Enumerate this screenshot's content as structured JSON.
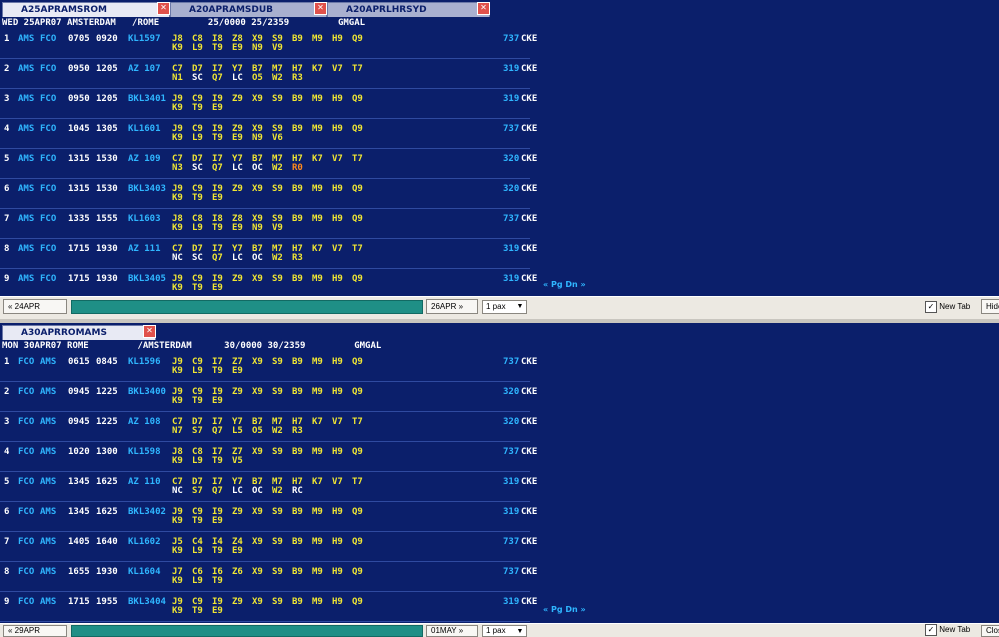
{
  "top": {
    "tabs": [
      {
        "label": "A25APRAMSROM",
        "active": true
      },
      {
        "label": "A20APRAMSDUB",
        "active": false
      },
      {
        "label": "A20APRLHRSYD",
        "active": false
      }
    ],
    "header": "WED 25APR07 AMSTERDAM   /ROME         25/0000 25/2359         GMGAL",
    "rows": [
      {
        "n": "1",
        "dep": "AMS",
        "arr": "FCO",
        "t1": "0705",
        "t2": "0920",
        "flt": "KL1597",
        "l1": [
          "J8",
          "C8",
          "I8",
          "Z8",
          "X9",
          "S9",
          "B9",
          "M9",
          "H9",
          "Q9"
        ],
        "l2": [
          "K9",
          "L9",
          "T9",
          "E9",
          "N9",
          "V9"
        ],
        "eq": "737"
      },
      {
        "n": "2",
        "dep": "AMS",
        "arr": "FCO",
        "t1": "0950",
        "t2": "1205",
        "flt": "AZ 107",
        "l1": [
          "C7",
          "D7",
          "I7",
          "Y7",
          "B7",
          "M7",
          "H7",
          "K7",
          "V7",
          "T7"
        ],
        "l2": [
          "N1",
          "SC",
          "Q7",
          "LC",
          "O5",
          "W2",
          "R3"
        ],
        "eq": "319"
      },
      {
        "n": "3",
        "dep": "AMS",
        "arr": "FCO",
        "t1": "0950",
        "t2": "1205",
        "flt": "BKL3401",
        "l1": [
          "J9",
          "C9",
          "I9",
          "Z9",
          "X9",
          "S9",
          "B9",
          "M9",
          "H9",
          "Q9"
        ],
        "l2": [
          "K9",
          "T9",
          "E9"
        ],
        "eq": "319"
      },
      {
        "n": "4",
        "dep": "AMS",
        "arr": "FCO",
        "t1": "1045",
        "t2": "1305",
        "flt": "KL1601",
        "l1": [
          "J9",
          "C9",
          "I9",
          "Z9",
          "X9",
          "S9",
          "B9",
          "M9",
          "H9",
          "Q9"
        ],
        "l2": [
          "K9",
          "L9",
          "T9",
          "E9",
          "N9",
          "V6"
        ],
        "eq": "737"
      },
      {
        "n": "5",
        "dep": "AMS",
        "arr": "FCO",
        "t1": "1315",
        "t2": "1530",
        "flt": "AZ 109",
        "l1": [
          "C7",
          "D7",
          "I7",
          "Y7",
          "B7",
          "M7",
          "H7",
          "K7",
          "V7",
          "T7"
        ],
        "l2": [
          "N3",
          "SC",
          "Q7",
          "LC",
          "OC",
          "W2",
          "R0"
        ],
        "eq": "320"
      },
      {
        "n": "6",
        "dep": "AMS",
        "arr": "FCO",
        "t1": "1315",
        "t2": "1530",
        "flt": "BKL3403",
        "l1": [
          "J9",
          "C9",
          "I9",
          "Z9",
          "X9",
          "S9",
          "B9",
          "M9",
          "H9",
          "Q9"
        ],
        "l2": [
          "K9",
          "T9",
          "E9"
        ],
        "eq": "320"
      },
      {
        "n": "7",
        "dep": "AMS",
        "arr": "FCO",
        "t1": "1335",
        "t2": "1555",
        "flt": "KL1603",
        "l1": [
          "J8",
          "C8",
          "I8",
          "Z8",
          "X9",
          "S9",
          "B9",
          "M9",
          "H9",
          "Q9"
        ],
        "l2": [
          "K9",
          "L9",
          "T9",
          "E9",
          "N9",
          "V9"
        ],
        "eq": "737"
      },
      {
        "n": "8",
        "dep": "AMS",
        "arr": "FCO",
        "t1": "1715",
        "t2": "1930",
        "flt": "AZ 111",
        "l1": [
          "C7",
          "D7",
          "I7",
          "Y7",
          "B7",
          "M7",
          "H7",
          "K7",
          "V7",
          "T7"
        ],
        "l2": [
          "NC",
          "SC",
          "Q7",
          "LC",
          "OC",
          "W2",
          "R3"
        ],
        "eq": "319"
      },
      {
        "n": "9",
        "dep": "AMS",
        "arr": "FCO",
        "t1": "1715",
        "t2": "1930",
        "flt": "BKL3405",
        "l1": [
          "J9",
          "C9",
          "I9",
          "Z9",
          "X9",
          "S9",
          "B9",
          "M9",
          "H9",
          "Q9"
        ],
        "l2": [
          "K9",
          "T9",
          "E9"
        ],
        "eq": "319"
      }
    ],
    "eq_suffix": "CKE",
    "pgdn": "« Pg Dn »",
    "nav": {
      "prev": "« 24APR",
      "next": "26APR »",
      "pax": "1 pax",
      "newtab": "New Tab",
      "hide": "Hide"
    }
  },
  "bottom": {
    "tabs": [
      {
        "label": "A30APRROMAMS",
        "active": true
      }
    ],
    "header": "MON 30APR07 ROME         /AMSTERDAM      30/0000 30/2359         GMGAL",
    "rows": [
      {
        "n": "1",
        "dep": "FCO",
        "arr": "AMS",
        "t1": "0615",
        "t2": "0845",
        "flt": "KL1596",
        "l1": [
          "J9",
          "C9",
          "I7",
          "Z7",
          "X9",
          "S9",
          "B9",
          "M9",
          "H9",
          "Q9"
        ],
        "l2": [
          "K9",
          "L9",
          "T9",
          "E9"
        ],
        "eq": "737"
      },
      {
        "n": "2",
        "dep": "FCO",
        "arr": "AMS",
        "t1": "0945",
        "t2": "1225",
        "flt": "BKL3400",
        "l1": [
          "J9",
          "C9",
          "I9",
          "Z9",
          "X9",
          "S9",
          "B9",
          "M9",
          "H9",
          "Q9"
        ],
        "l2": [
          "K9",
          "T9",
          "E9"
        ],
        "eq": "320"
      },
      {
        "n": "3",
        "dep": "FCO",
        "arr": "AMS",
        "t1": "0945",
        "t2": "1225",
        "flt": "AZ 108",
        "l1": [
          "C7",
          "D7",
          "I7",
          "Y7",
          "B7",
          "M7",
          "H7",
          "K7",
          "V7",
          "T7"
        ],
        "l2": [
          "N7",
          "S7",
          "Q7",
          "L5",
          "O5",
          "W2",
          "R3"
        ],
        "eq": "320"
      },
      {
        "n": "4",
        "dep": "FCO",
        "arr": "AMS",
        "t1": "1020",
        "t2": "1300",
        "flt": "KL1598",
        "l1": [
          "J8",
          "C8",
          "I7",
          "Z7",
          "X9",
          "S9",
          "B9",
          "M9",
          "H9",
          "Q9"
        ],
        "l2": [
          "K9",
          "L9",
          "T9",
          "V5"
        ],
        "eq": "737"
      },
      {
        "n": "5",
        "dep": "FCO",
        "arr": "AMS",
        "t1": "1345",
        "t2": "1625",
        "flt": "AZ 110",
        "l1": [
          "C7",
          "D7",
          "I7",
          "Y7",
          "B7",
          "M7",
          "H7",
          "K7",
          "V7",
          "T7"
        ],
        "l2": [
          "NC",
          "S7",
          "Q7",
          "LC",
          "OC",
          "W2",
          "RC"
        ],
        "eq": "319"
      },
      {
        "n": "6",
        "dep": "FCO",
        "arr": "AMS",
        "t1": "1345",
        "t2": "1625",
        "flt": "BKL3402",
        "l1": [
          "J9",
          "C9",
          "I9",
          "Z9",
          "X9",
          "S9",
          "B9",
          "M9",
          "H9",
          "Q9"
        ],
        "l2": [
          "K9",
          "T9",
          "E9"
        ],
        "eq": "319"
      },
      {
        "n": "7",
        "dep": "FCO",
        "arr": "AMS",
        "t1": "1405",
        "t2": "1640",
        "flt": "KL1602",
        "l1": [
          "J5",
          "C4",
          "I4",
          "Z4",
          "X9",
          "S9",
          "B9",
          "M9",
          "H9",
          "Q9"
        ],
        "l2": [
          "K9",
          "L9",
          "T9",
          "E9"
        ],
        "eq": "737"
      },
      {
        "n": "8",
        "dep": "FCO",
        "arr": "AMS",
        "t1": "1655",
        "t2": "1930",
        "flt": "KL1604",
        "l1": [
          "J7",
          "C6",
          "I6",
          "Z6",
          "X9",
          "S9",
          "B9",
          "M9",
          "H9",
          "Q9"
        ],
        "l2": [
          "K9",
          "L9",
          "T9"
        ],
        "eq": "737"
      },
      {
        "n": "9",
        "dep": "FCO",
        "arr": "AMS",
        "t1": "1715",
        "t2": "1955",
        "flt": "BKL3404",
        "l1": [
          "J9",
          "C9",
          "I9",
          "Z9",
          "X9",
          "S9",
          "B9",
          "M9",
          "H9",
          "Q9"
        ],
        "l2": [
          "K9",
          "T9",
          "E9"
        ],
        "eq": "319"
      }
    ],
    "eq_suffix": "CKE",
    "pgdn": "« Pg Dn »",
    "nav": {
      "prev": "« 29APR",
      "next": "01MAY »",
      "pax": "1 pax",
      "newtab": "New Tab",
      "hide": "Close"
    }
  },
  "colors": {
    "bg": "#0b1f6b",
    "yellow": "#f0e633",
    "cyan": "#2fb6ff",
    "orange": "#ff8a1a",
    "teal": "#1f8f86"
  }
}
